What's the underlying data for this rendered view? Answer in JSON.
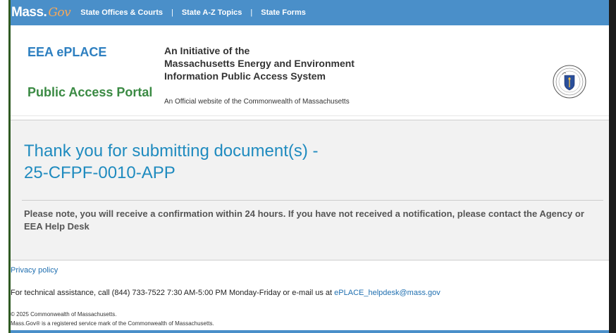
{
  "topbar": {
    "brand_mass": "Mass.",
    "brand_gov": "Gov",
    "links": [
      "State Offices & Courts",
      "State A-Z Topics",
      "State Forms"
    ],
    "separator": "|"
  },
  "header": {
    "title_line1": "EEA ePLACE",
    "title_line2": "Public Access Portal",
    "initiative_line1": "An Initiative of the",
    "initiative_line2": "Massachusetts Energy and Environment",
    "initiative_line3": "Information Public Access System",
    "official": "An Official website of the Commonwealth of Massachusetts",
    "seal_icon": "massachusetts-seal-icon"
  },
  "main": {
    "arrow_icon": "arrow-right-icon",
    "thanks_line1": "Thank you for submitting document(s) -",
    "thanks_line2": "25-CFPF-0010-APP",
    "note": "Please note, you will receive a confirmation within 24 hours. If you have not received a notification, please contact the Agency or EEA Help Desk"
  },
  "footer": {
    "privacy": "Privacy policy",
    "tech_text": "For technical assistance, call (844) 733-7522 7:30 AM-5:00 PM Monday-Friday or e-mail us at",
    "tech_email": "ePLACE_helpdesk@mass.gov",
    "copyright": "© 2025 Commonwealth of Massachusetts.",
    "trademark": "Mass.Gov® is a registered service mark of the Commonwealth of Massachusetts."
  },
  "colors": {
    "topbar": "#4a8fc9",
    "title_blue": "#2d7fc0",
    "title_green": "#3a8a43",
    "thanks_blue": "#1f8bbf",
    "gov_orange": "#f6a85a"
  }
}
